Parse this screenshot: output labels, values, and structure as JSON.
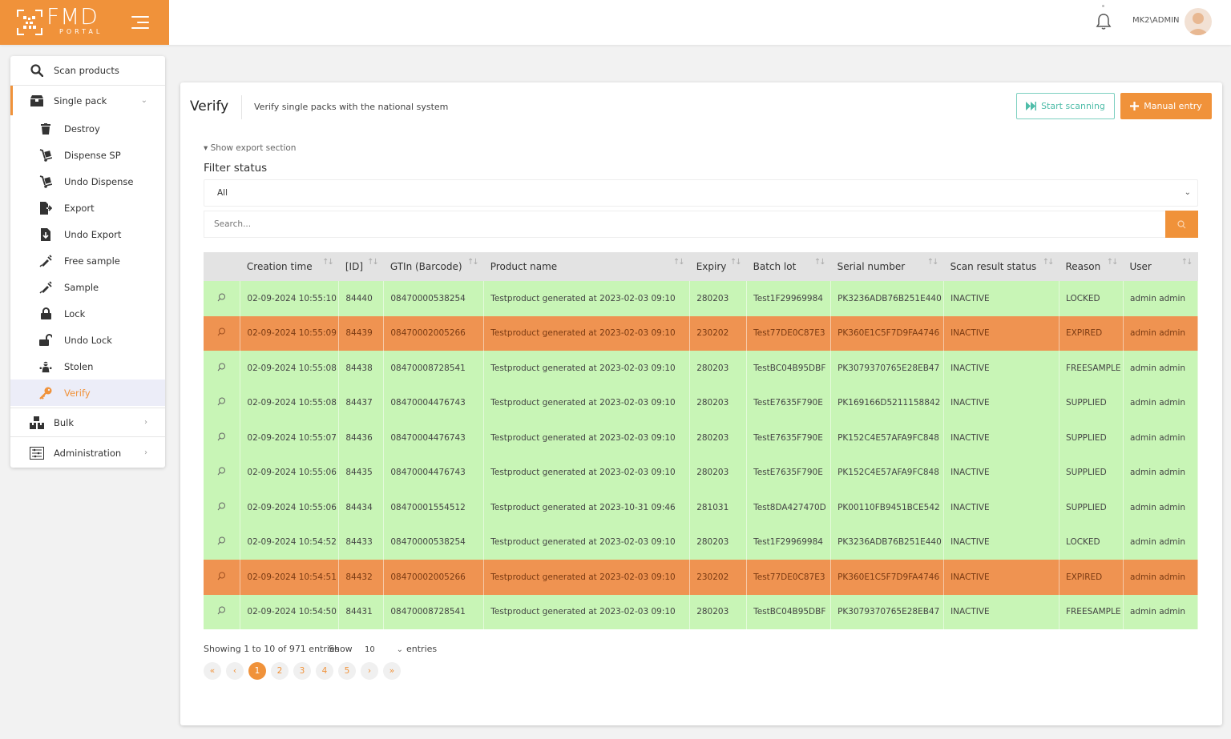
{
  "header": {
    "logo_title": "FMD",
    "logo_subtitle": "PORTAL",
    "user": "MK2\\ADMIN"
  },
  "sidebar": {
    "top_items": [
      {
        "label": "Scan products",
        "icon": "search-icon"
      },
      {
        "label": "Single pack",
        "icon": "box-icon"
      }
    ],
    "sub_items": [
      {
        "label": "Destroy",
        "icon": "trash-icon"
      },
      {
        "label": "Dispense SP",
        "icon": "dolly-icon"
      },
      {
        "label": "Undo Dispense",
        "icon": "dolly-icon"
      },
      {
        "label": "Export",
        "icon": "file-export-icon"
      },
      {
        "label": "Undo Export",
        "icon": "file-import-icon"
      },
      {
        "label": "Free sample",
        "icon": "syringe-icon"
      },
      {
        "label": "Sample",
        "icon": "syringe-icon"
      },
      {
        "label": "Lock",
        "icon": "lock-icon"
      },
      {
        "label": "Undo Lock",
        "icon": "unlock-icon"
      },
      {
        "label": "Stolen",
        "icon": "thief-icon"
      },
      {
        "label": "Verify",
        "icon": "key-icon"
      }
    ],
    "bottom_items": [
      {
        "label": "Bulk",
        "icon": "boxes-icon"
      },
      {
        "label": "Administration",
        "icon": "admin-icon"
      }
    ]
  },
  "page": {
    "title": "Verify",
    "subtitle": "Verify single packs with the national system",
    "start_scanning": "Start scanning",
    "manual_entry": "Manual entry",
    "export_toggle": "Show export section",
    "filter_label": "Filter status",
    "filter_value": "All",
    "search_placeholder": "Search..."
  },
  "table": {
    "columns": [
      "Creation time",
      "[ID]",
      "GTIn (Barcode)",
      "Product name",
      "Expiry",
      "Batch lot",
      "Serial number",
      "Scan result status",
      "Reason",
      "User"
    ],
    "rows": [
      {
        "status": "ok",
        "cells": [
          "02-09-2024 10:55:10",
          "84440",
          "08470000538254",
          "Testproduct generated at 2023-02-03 09:10",
          "280203",
          "Test1F29969984",
          "PK3236ADB76B251E440",
          "INACTIVE",
          "LOCKED",
          "admin admin"
        ]
      },
      {
        "status": "bad",
        "cells": [
          "02-09-2024 10:55:09",
          "84439",
          "08470002005266",
          "Testproduct generated at 2023-02-03 09:10",
          "230202",
          "Test77DE0C87E3",
          "PK360E1C5F7D9FA4746",
          "INACTIVE",
          "EXPIRED",
          "admin admin"
        ]
      },
      {
        "status": "ok",
        "cells": [
          "02-09-2024 10:55:08",
          "84438",
          "08470008728541",
          "Testproduct generated at 2023-02-03 09:10",
          "280203",
          "TestBC04B95DBF",
          "PK3079370765E28EB47",
          "INACTIVE",
          "FREESAMPLE",
          "admin admin"
        ]
      },
      {
        "status": "ok",
        "cells": [
          "02-09-2024 10:55:08",
          "84437",
          "08470004476743",
          "Testproduct generated at 2023-02-03 09:10",
          "280203",
          "TestE7635F790E",
          "PK169166D5211158842",
          "INACTIVE",
          "SUPPLIED",
          "admin admin"
        ]
      },
      {
        "status": "ok",
        "cells": [
          "02-09-2024 10:55:07",
          "84436",
          "08470004476743",
          "Testproduct generated at 2023-02-03 09:10",
          "280203",
          "TestE7635F790E",
          "PK152C4E57AFA9FC848",
          "INACTIVE",
          "SUPPLIED",
          "admin admin"
        ]
      },
      {
        "status": "ok",
        "cells": [
          "02-09-2024 10:55:06",
          "84435",
          "08470004476743",
          "Testproduct generated at 2023-02-03 09:10",
          "280203",
          "TestE7635F790E",
          "PK152C4E57AFA9FC848",
          "INACTIVE",
          "SUPPLIED",
          "admin admin"
        ]
      },
      {
        "status": "ok",
        "cells": [
          "02-09-2024 10:55:06",
          "84434",
          "08470001554512",
          "Testproduct generated at 2023-10-31 09:46",
          "281031",
          "Test8DA427470D",
          "PK00110FB9451BCE542",
          "INACTIVE",
          "SUPPLIED",
          "admin admin"
        ]
      },
      {
        "status": "ok",
        "cells": [
          "02-09-2024 10:54:52",
          "84433",
          "08470000538254",
          "Testproduct generated at 2023-02-03 09:10",
          "280203",
          "Test1F29969984",
          "PK3236ADB76B251E440",
          "INACTIVE",
          "LOCKED",
          "admin admin"
        ]
      },
      {
        "status": "bad",
        "cells": [
          "02-09-2024 10:54:51",
          "84432",
          "08470002005266",
          "Testproduct generated at 2023-02-03 09:10",
          "230202",
          "Test77DE0C87E3",
          "PK360E1C5F7D9FA4746",
          "INACTIVE",
          "EXPIRED",
          "admin admin"
        ]
      },
      {
        "status": "ok",
        "cells": [
          "02-09-2024 10:54:50",
          "84431",
          "08470008728541",
          "Testproduct generated at 2023-02-03 09:10",
          "280203",
          "TestBC04B95DBF",
          "PK3079370765E28EB47",
          "INACTIVE",
          "FREESAMPLE",
          "admin admin"
        ]
      }
    ]
  },
  "footer": {
    "info": "Showing 1 to 10 of 971 entries",
    "show": "Show",
    "page_length": "10",
    "entries": "entries",
    "pages": [
      "1",
      "2",
      "3",
      "4",
      "5"
    ],
    "first": "«",
    "prev": "‹",
    "next": "›",
    "last": "»"
  },
  "colors": {
    "accent": "#f0923a",
    "row_ok": "#c8f5b6",
    "row_bad": "#ef9351",
    "scan_button": "#4fbda9"
  }
}
